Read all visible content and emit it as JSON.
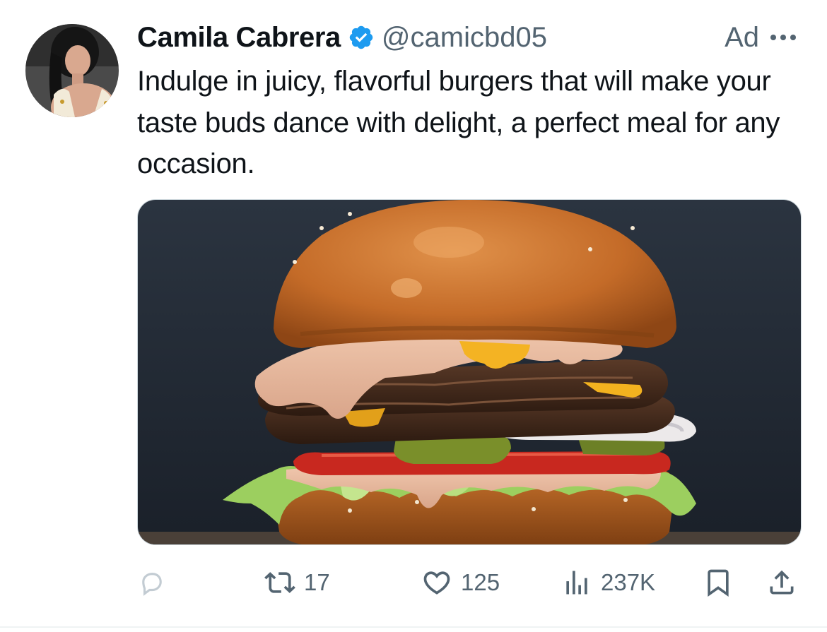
{
  "tweet": {
    "author": {
      "display_name": "Camila Cabrera",
      "handle": "@camicbd05",
      "verified": true,
      "verified_color": "#1d9bf0"
    },
    "ad_label": "Ad",
    "text": "Indulge in juicy, flavorful burgers that will make your taste buds dance with delight, a perfect meal for any occasion.",
    "media": {
      "subject": "cheeseburger-photo"
    },
    "actions": {
      "reply": {
        "icon": "reply-icon",
        "count": ""
      },
      "retweet": {
        "icon": "retweet-icon",
        "count": "17"
      },
      "like": {
        "icon": "heart-icon",
        "count": "125"
      },
      "views": {
        "icon": "views-icon",
        "count": "237K"
      },
      "bookmark": {
        "icon": "bookmark-icon"
      },
      "share": {
        "icon": "share-icon"
      }
    }
  },
  "colors": {
    "text_primary": "#0f1419",
    "text_secondary": "#536471",
    "accent": "#1d9bf0"
  }
}
